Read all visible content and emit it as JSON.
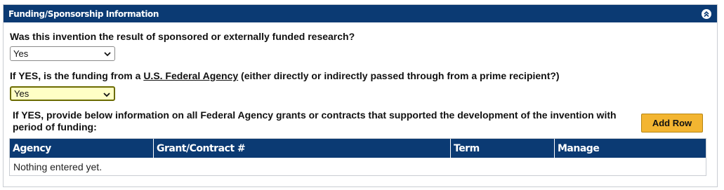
{
  "panel": {
    "title": "Funding/Sponsorship Information",
    "collapse_icon": "double-chevron-up-icon"
  },
  "q1": {
    "label": "Was this invention the result of sponsored or externally funded research?",
    "selected": "Yes"
  },
  "q2": {
    "prefix": "If YES, is the funding from a ",
    "link": "U.S. Federal Agency",
    "suffix": " (either directly or indirectly passed through from a prime recipient?)",
    "selected": "Yes"
  },
  "grants": {
    "instructions": "If YES, provide below information on all Federal Agency grants or contracts that supported the development of the invention with period of funding:",
    "add_row_label": "Add Row",
    "columns": [
      "Agency",
      "Grant/Contract #",
      "Term",
      "Manage"
    ],
    "empty_text": "Nothing entered yet."
  },
  "colors": {
    "header_bg": "#0b3a73",
    "button_bg": "#f3b531",
    "highlight_select_bg": "#ffffc6"
  }
}
